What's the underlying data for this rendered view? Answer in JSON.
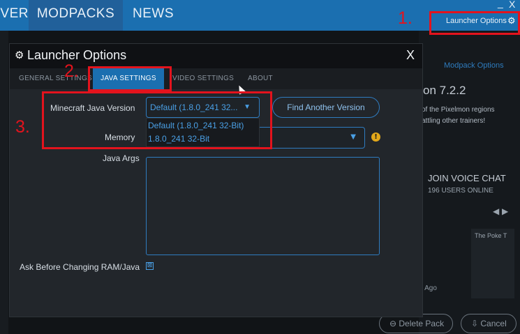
{
  "topbar": {
    "tabs": [
      "VER",
      "MODPACKS",
      "NEWS"
    ],
    "min_label": "_",
    "close_label": "X",
    "launcher_options_label": "Launcher Options"
  },
  "annotations": {
    "one": "1.",
    "two": "2.",
    "three": "3."
  },
  "background": {
    "modpack_options": "Modpack Options",
    "version": "on 7.2.2",
    "desc": "of the Pixelmon regions\nattling other trainers!",
    "voice": "JOIN VOICE CHAT",
    "users": "196 USERS ONLINE",
    "card_title": "The Poke T",
    "month": "nth Ago",
    "delete_pack": "Delete Pack",
    "cancel": "Cancel"
  },
  "modal": {
    "title": "Launcher Options",
    "close": "X",
    "tabs": [
      "GENERAL SETTINGS",
      "JAVA SETTINGS",
      "VIDEO SETTINGS",
      "ABOUT"
    ],
    "java_version_label": "Minecraft Java Version",
    "java_selected": "Default (1.8.0_241 32...",
    "java_options": [
      "Default (1.8.0_241 32-Bit)",
      "1.8.0_241 32-Bit"
    ],
    "find_another": "Find Another Version",
    "memory_label": "Memory",
    "java_args_label": "Java Args",
    "ask_label": "Ask Before Changing RAM/Java",
    "warn_icon": "!",
    "checkbox_mark": "⊠"
  },
  "colors": {
    "accent": "#1b6fb0",
    "annotation": "#e3131d",
    "link": "#4aa0e6"
  }
}
